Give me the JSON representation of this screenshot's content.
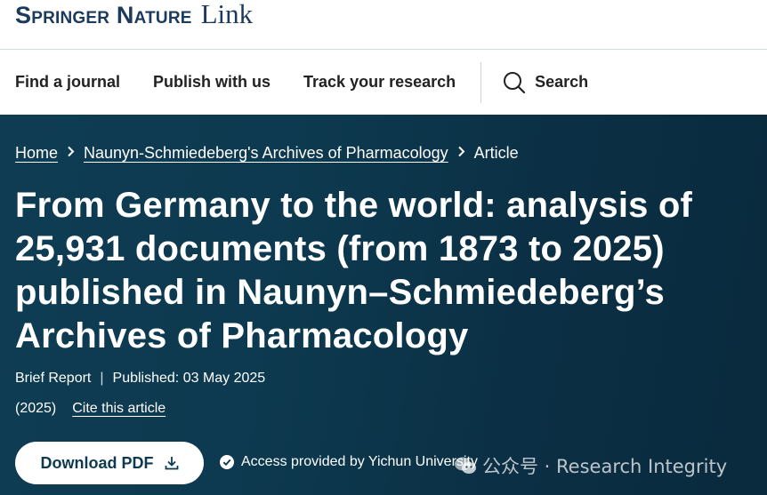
{
  "brand": {
    "main": "Springer Nature",
    "link": "Link"
  },
  "nav": {
    "items": [
      "Find a journal",
      "Publish with us",
      "Track your research"
    ],
    "search_label": "Search"
  },
  "breadcrumb": {
    "home": "Home",
    "journal": "Naunyn-Schmiedeberg's Archives of Pharmacology",
    "current": "Article"
  },
  "article": {
    "title": "From Germany to the world: analysis of 25,931 documents (from 1873 to 2025) published in Naunyn–Schmiedeberg’s Archives of Pharmacology",
    "type": "Brief Report",
    "published": "Published: 03 May 2025",
    "year": "(2025)",
    "cite_label": "Cite this article"
  },
  "actions": {
    "download_label": "Download PDF",
    "access_text": "Access provided by Yichun University"
  },
  "watermark": {
    "text": "公众号 · Research Integrity"
  },
  "colors": {
    "hero_bg": "#0d3a50",
    "brand": "#1b3a5c"
  },
  "icons": [
    "search-icon",
    "chevron-right-icon",
    "download-icon",
    "check-circle-icon",
    "wechat-icon"
  ]
}
